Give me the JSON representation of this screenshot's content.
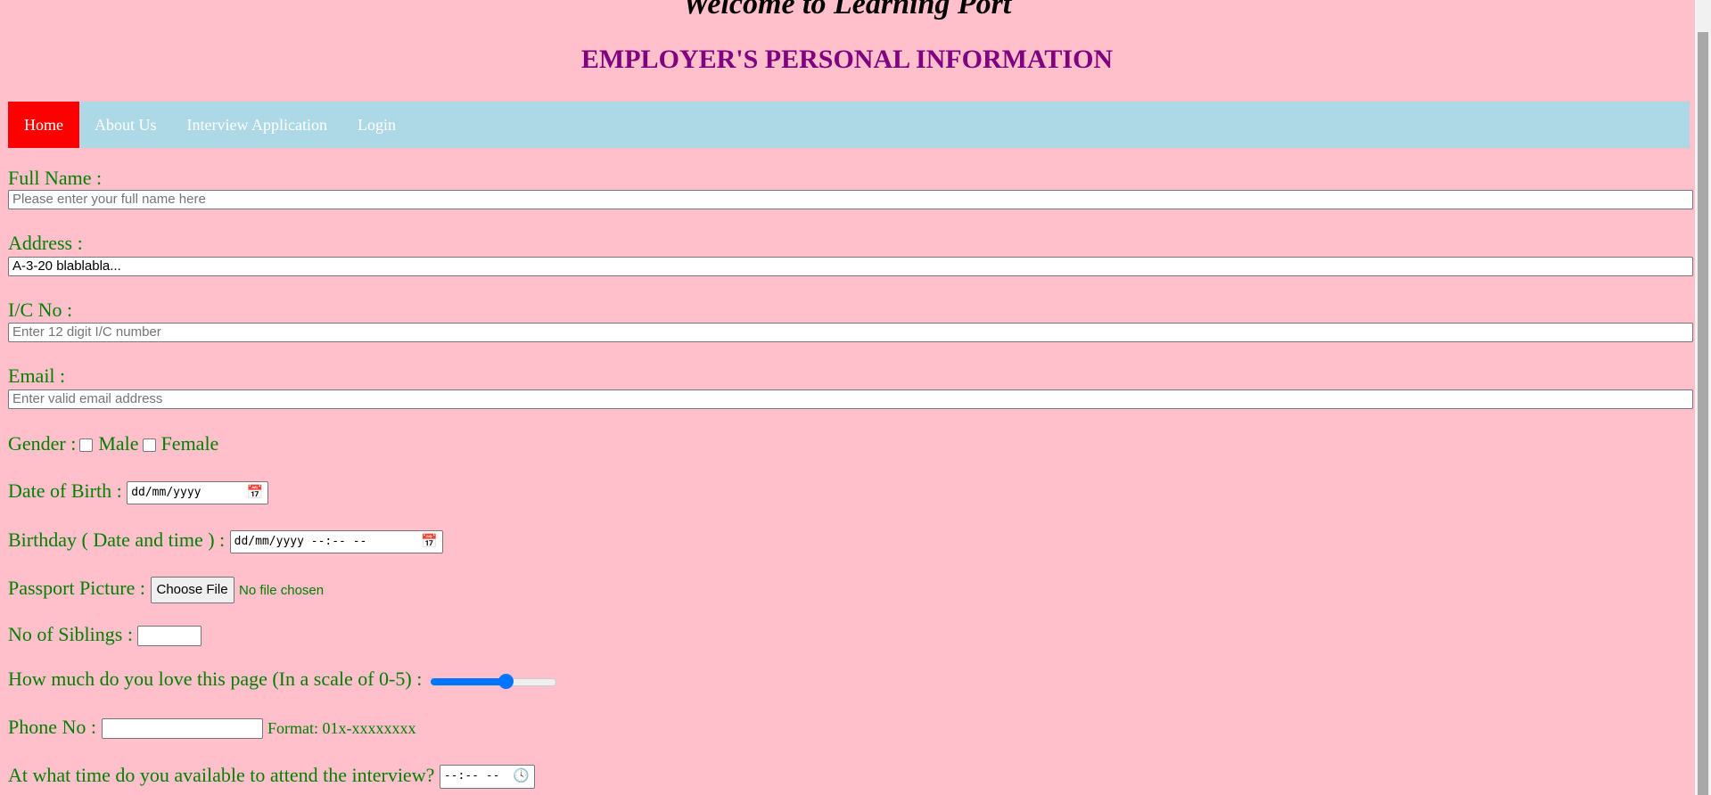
{
  "header": {
    "welcome": "Welcome to Learning Port",
    "title": "EMPLOYER'S PERSONAL INFORMATION"
  },
  "nav": {
    "items": [
      {
        "label": "Home",
        "active": true
      },
      {
        "label": "About Us"
      },
      {
        "label": "Interview Application"
      },
      {
        "label": "Login"
      }
    ]
  },
  "colors": {
    "background": "#FFC0CB",
    "nav": "#ADD8E6",
    "active": "#FF0000",
    "label": "#008000",
    "title": "#800080"
  },
  "form": {
    "full_name": {
      "label": "Full Name :",
      "placeholder": "Please enter your full name here"
    },
    "address": {
      "label": "Address :",
      "value": "A-3-20 blablabla..."
    },
    "ic": {
      "label": "I/C No :",
      "placeholder": "Enter 12 digit I/C number"
    },
    "email": {
      "label": "Email :",
      "placeholder": "Enter valid email address"
    },
    "gender": {
      "label": "Gender :",
      "options": [
        "Male",
        "Female"
      ]
    },
    "dob": {
      "label": "Date of Birth :",
      "placeholder": "dd/mm/yyyy"
    },
    "birthday": {
      "label": "Birthday ( Date and time ) :",
      "placeholder": "dd/mm/yyyy --:-- --"
    },
    "passport": {
      "label": "Passport Picture :",
      "button": "Choose File",
      "status": "No file chosen"
    },
    "siblings": {
      "label": "No of Siblings :"
    },
    "love": {
      "label": "How much do you love this page (In a scale of 0-5) :",
      "value": 3,
      "min": 0,
      "max": 5
    },
    "phone": {
      "label": "Phone No :",
      "hint": "Format: 01x-xxxxxxxx"
    },
    "interview_time": {
      "label": "At what time do you available to attend the interview?",
      "placeholder": "--:-- --"
    }
  }
}
